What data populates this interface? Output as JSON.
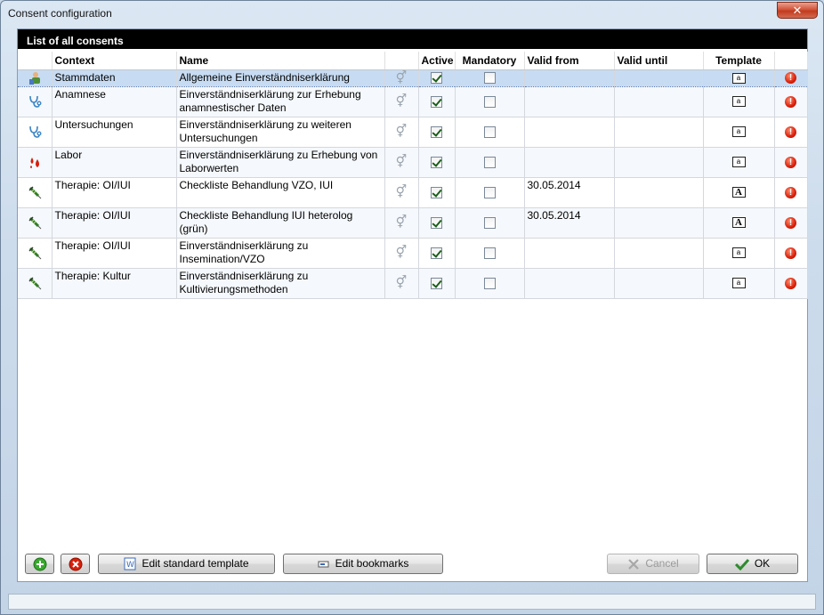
{
  "window": {
    "title": "Consent configuration",
    "close_label": "✕"
  },
  "panel": {
    "title": "List of all consents"
  },
  "columns": {
    "context": "Context",
    "name": "Name",
    "active": "Active",
    "mandatory": "Mandatory",
    "valid_from": "Valid from",
    "valid_until": "Valid until",
    "template": "Template"
  },
  "rows": [
    {
      "icon": "person-icon",
      "context": "Stammdaten",
      "name": "Allgemeine Einverständniserklärung",
      "active": true,
      "mandatory": false,
      "valid_from": "",
      "valid_until": "",
      "template": "a",
      "selected": true
    },
    {
      "icon": "stethoscope-icon",
      "context": "Anamnese",
      "name": "Einverständniserklärung zur Erhebung anamnestischer Daten",
      "active": true,
      "mandatory": false,
      "valid_from": "",
      "valid_until": "",
      "template": "a",
      "selected": false
    },
    {
      "icon": "stethoscope-icon",
      "context": "Untersuchungen",
      "name": "Einverständniserklärung zu weiteren Untersuchungen",
      "active": true,
      "mandatory": false,
      "valid_from": "",
      "valid_until": "",
      "template": "a",
      "selected": false
    },
    {
      "icon": "blood-drops-icon",
      "context": "Labor",
      "name": "Einverständniserklärung zu Erhebung von Laborwerten",
      "active": true,
      "mandatory": false,
      "valid_from": "",
      "valid_until": "",
      "template": "a",
      "selected": false
    },
    {
      "icon": "syringe-icon",
      "context": "Therapie: OI/IUI",
      "name": "Checkliste Behandlung VZO, IUI",
      "active": true,
      "mandatory": false,
      "valid_from": "30.05.2014",
      "valid_until": "",
      "template": "A",
      "selected": false
    },
    {
      "icon": "syringe-icon",
      "context": "Therapie: OI/IUI",
      "name": "Checkliste Behandlung  IUI heterolog (grün)",
      "active": true,
      "mandatory": false,
      "valid_from": "30.05.2014",
      "valid_until": "",
      "template": "A",
      "selected": false
    },
    {
      "icon": "syringe-icon",
      "context": "Therapie: OI/IUI",
      "name": "Einverständniserklärung zu Insemination/VZO",
      "active": true,
      "mandatory": false,
      "valid_from": "",
      "valid_until": "",
      "template": "a",
      "selected": false
    },
    {
      "icon": "syringe-icon",
      "context": "Therapie: Kultur",
      "name": "Einverständniserklärung zu Kultivierungsmethoden",
      "active": true,
      "mandatory": false,
      "valid_from": "",
      "valid_until": "",
      "template": "a",
      "selected": false
    }
  ],
  "gender_symbol": "⚥",
  "alert_symbol": "!",
  "buttons": {
    "edit_standard_template": "Edit standard template",
    "edit_bookmarks": "Edit bookmarks",
    "cancel": "Cancel",
    "ok": "OK"
  },
  "colors": {
    "header_bg": "#000000",
    "selected_row": "#c7dcf3",
    "add_green": "#3aa82f",
    "delete_red": "#d8200b",
    "ok_check": "#2e8b2e"
  }
}
